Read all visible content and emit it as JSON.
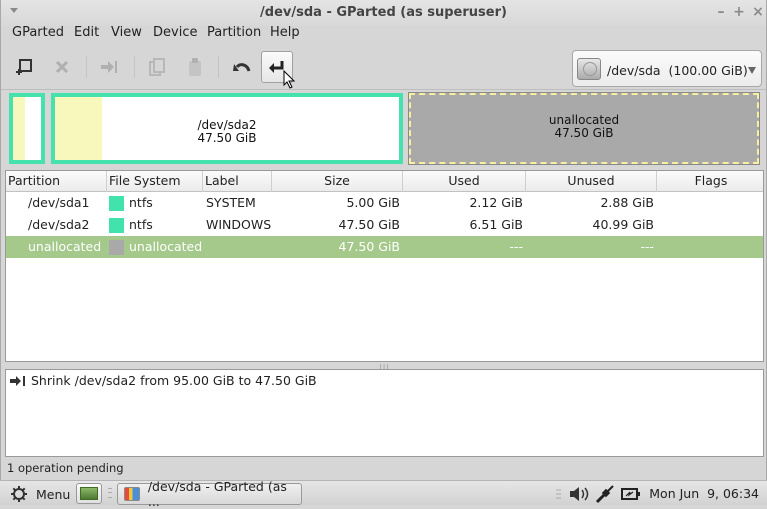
{
  "window": {
    "title": "/dev/sda - GParted (as superuser)",
    "controls": [
      "minimize",
      "maximize",
      "close"
    ]
  },
  "menubar": {
    "items": [
      {
        "label": "GParted",
        "mnemonic": "G"
      },
      {
        "label": "Edit",
        "mnemonic": "E"
      },
      {
        "label": "View",
        "mnemonic": "V"
      },
      {
        "label": "Device",
        "mnemonic": "D"
      },
      {
        "label": "Partition",
        "mnemonic": "P"
      },
      {
        "label": "Help",
        "mnemonic": "H"
      }
    ]
  },
  "toolbar": {
    "buttons": [
      {
        "name": "new-partition",
        "icon": "new-partition-icon",
        "enabled": true
      },
      {
        "name": "delete-partition",
        "icon": "delete-icon",
        "enabled": false
      },
      {
        "name": "resize-move",
        "icon": "resize-move-icon",
        "enabled": false
      },
      {
        "name": "copy",
        "icon": "copy-icon",
        "enabled": false
      },
      {
        "name": "paste",
        "icon": "paste-icon",
        "enabled": false
      },
      {
        "name": "undo",
        "icon": "undo-icon",
        "enabled": true
      },
      {
        "name": "apply",
        "icon": "apply-icon",
        "enabled": true,
        "pressed": true
      }
    ]
  },
  "device_selector": {
    "label": "/dev/sda  (100.00 GiB)",
    "icon": "hard-disk-icon"
  },
  "disk_map": {
    "partitions": [
      {
        "name": "/dev/sda1",
        "size": "5.00 GiB",
        "used_fraction": 0.424,
        "selected": false
      },
      {
        "name": "/dev/sda2",
        "size": "47.50 GiB",
        "used_fraction": 0.137,
        "selected": true,
        "label1": "/dev/sda2",
        "label2": "47.50 GiB"
      },
      {
        "name": "unallocated",
        "size": "47.50 GiB",
        "label1": "unallocated",
        "label2": "47.50 GiB"
      }
    ]
  },
  "table": {
    "columns": [
      "Partition",
      "File System",
      "Label",
      "Size",
      "Used",
      "Unused",
      "Flags"
    ],
    "rows": [
      {
        "partition": "/dev/sda1",
        "fs": "ntfs",
        "fs_color": "#42e2ad",
        "label": "SYSTEM",
        "size": "5.00 GiB",
        "used": "2.12 GiB",
        "unused": "2.88 GiB",
        "flags": ""
      },
      {
        "partition": "/dev/sda2",
        "fs": "ntfs",
        "fs_color": "#42e2ad",
        "label": "WINDOWS",
        "size": "47.50 GiB",
        "used": "6.51 GiB",
        "unused": "40.99 GiB",
        "flags": ""
      },
      {
        "partition": "unallocated",
        "fs": "unallocated",
        "fs_color": "#a9a9a9",
        "label": "",
        "size": "47.50 GiB",
        "used": "---",
        "unused": "---",
        "flags": "",
        "selected": true
      }
    ]
  },
  "operations": {
    "items": [
      {
        "icon": "resize-move-icon",
        "text": "Shrink /dev/sda2 from 95.00 GiB to 47.50 GiB"
      }
    ]
  },
  "status": {
    "text": "1 operation pending"
  },
  "panel": {
    "menu_label": "Menu",
    "task_label": "/dev/sda - GParted (as ...",
    "clock": "Mon Jun  9, 06:34"
  },
  "colors": {
    "ntfs": "#42e2ad",
    "unallocated": "#a9a9a9",
    "used": "#f8f8bc",
    "selection_row": "#a4c98a"
  }
}
